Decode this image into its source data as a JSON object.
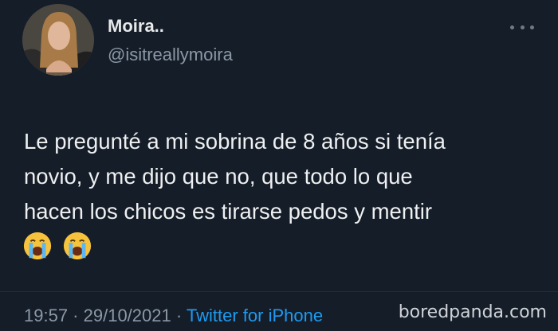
{
  "author": {
    "display_name": "Moira..",
    "handle": "@isitreallymoira"
  },
  "tweet": {
    "lines": [
      "Le pregunté a mi sobrina de 8 años si tenía",
      "novio, y me dijo que no, que todo lo que",
      "hacen los chicos es tirarse pedos y mentir"
    ],
    "emojis": [
      "loudly-crying-face",
      "loudly-crying-face"
    ]
  },
  "meta": {
    "time": "19:57",
    "separator": " · ",
    "date": "29/10/2021",
    "source": "Twitter for iPhone"
  },
  "watermark": "boredpanda.com",
  "colors": {
    "background": "#151d29",
    "text": "#e7e9ea",
    "secondary": "#8b98a5",
    "link": "#1d9bf0"
  }
}
